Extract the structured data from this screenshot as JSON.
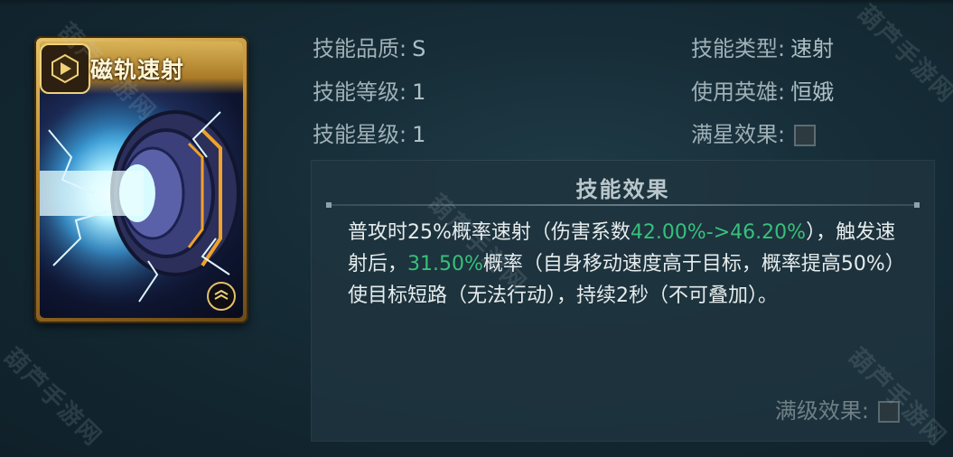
{
  "card": {
    "title": "磁轨速射",
    "emblem_icon": "hex-emblem-icon",
    "corner_icon": "rank-chevron-icon"
  },
  "info": {
    "quality_label": "技能品质:",
    "quality_value": "S",
    "level_label": "技能等级:",
    "level_value": "1",
    "star_label": "技能星级:",
    "star_value": "1",
    "type_label": "技能类型:",
    "type_value": "速射",
    "hero_label": "使用英雄:",
    "hero_value": "恒娥",
    "fullstar_label": "满星效果:"
  },
  "effect": {
    "title": "技能效果",
    "seg1": "普攻时25%概率速射（伤害系数",
    "seg2": "42.00%->46.20%",
    "seg3": "），触发速射后，",
    "seg4": "31.50%",
    "seg5": "概率（自身移动速度高于目标，概率提高50%）使目标短路（无法行动），持续2秒（不可叠加）。",
    "max_level_label": "满级效果:"
  },
  "watermark": "葫芦手游网",
  "colors": {
    "highlight": "#37c07b",
    "card_gold": "#d9b256"
  }
}
